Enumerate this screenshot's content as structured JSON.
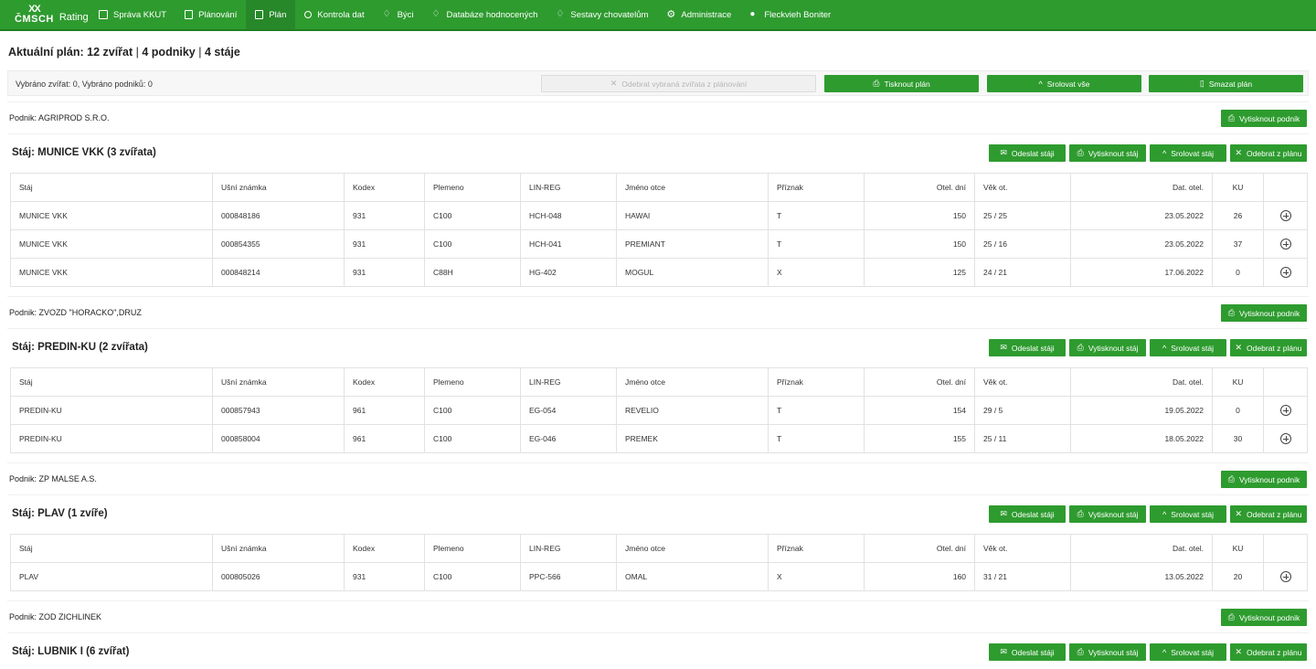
{
  "brand": {
    "mark": "ČMSCH",
    "mark_top": "XX",
    "product": "Rating"
  },
  "nav": [
    {
      "label": "Správa KKUT",
      "icon": "box-arrow-icon"
    },
    {
      "label": "Plánování",
      "icon": "document-icon"
    },
    {
      "label": "Plán",
      "icon": "document-icon",
      "active": true
    },
    {
      "label": "Kontrola dat",
      "icon": "search-icon"
    },
    {
      "label": "Býci",
      "icon": "cow-icon"
    },
    {
      "label": "Databáze hodnocených",
      "icon": "cow-icon"
    },
    {
      "label": "Sestavy chovatelům",
      "icon": "cow-icon"
    },
    {
      "label": "Administrace",
      "icon": "gear-icon"
    },
    {
      "label": "Fleckvieh Boniter",
      "icon": "user-icon"
    }
  ],
  "heading": {
    "title": "Aktuální plán: 12 zvířat",
    "p2": "4 podniky",
    "p3": "4 stáje",
    "sep": "|"
  },
  "selection": {
    "text": "Vybráno zvířat: 0, Vybráno podniků: 0",
    "remove_selected": "Odebrat vybraná zvířata z plánování",
    "print_plan": "Tisknout plán",
    "collapse_all": "Srolovat vše",
    "delete_plan": "Smazat plán"
  },
  "stable_buttons": {
    "send": "Odeslat stáji",
    "print": "Vytisknout stáj",
    "collapse": "Srolovat stáj",
    "remove": "Odebrat z plánu"
  },
  "print_podnik": "Vytisknout podnik",
  "columns": [
    "Stáj",
    "Ušní známka",
    "Kodex",
    "Plemeno",
    "LIN-REG",
    "Jméno otce",
    "Příznak",
    "Otel. dní",
    "Věk ot.",
    "Dat. otel.",
    "KU",
    ""
  ],
  "podniky": [
    {
      "label": "Podnik: AGRIPROD S.R.O.",
      "stable": "Stáj: MUNICE VKK (3 zvířata)",
      "rows": [
        [
          "MUNICE VKK",
          "000848186",
          "931",
          "C100",
          "HCH-048",
          "HAWAI",
          "T",
          "150",
          "25 / 25",
          "23.05.2022",
          "26"
        ],
        [
          "MUNICE VKK",
          "000854355",
          "931",
          "C100",
          "HCH-041",
          "PREMIANT",
          "T",
          "150",
          "25 / 16",
          "23.05.2022",
          "37"
        ],
        [
          "MUNICE VKK",
          "000848214",
          "931",
          "C88H",
          "HG-402",
          "MOGUL",
          "X",
          "125",
          "24 / 21",
          "17.06.2022",
          "0"
        ]
      ]
    },
    {
      "label": "Podnik: ZVOZD \"HORACKO\",DRUZ",
      "stable": "Stáj: PREDIN-KU (2 zvířata)",
      "rows": [
        [
          "PREDIN-KU",
          "000857943",
          "961",
          "C100",
          "EG-054",
          "REVELIO",
          "T",
          "154",
          "29 / 5",
          "19.05.2022",
          "0"
        ],
        [
          "PREDIN-KU",
          "000858004",
          "961",
          "C100",
          "EG-046",
          "PREMEK",
          "T",
          "155",
          "25 / 11",
          "18.05.2022",
          "30"
        ]
      ]
    },
    {
      "label": "Podnik: ZP MALSE A.S.",
      "stable": "Stáj: PLAV (1 zvíře)",
      "rows": [
        [
          "PLAV",
          "000805026",
          "931",
          "C100",
          "PPC-566",
          "OMAL",
          "X",
          "160",
          "31 / 21",
          "13.05.2022",
          "20"
        ]
      ]
    },
    {
      "label": "Podnik: ZOD ZICHLINEK",
      "stable": "Stáj: LUBNIK I (6 zvířat)",
      "rows": []
    }
  ]
}
